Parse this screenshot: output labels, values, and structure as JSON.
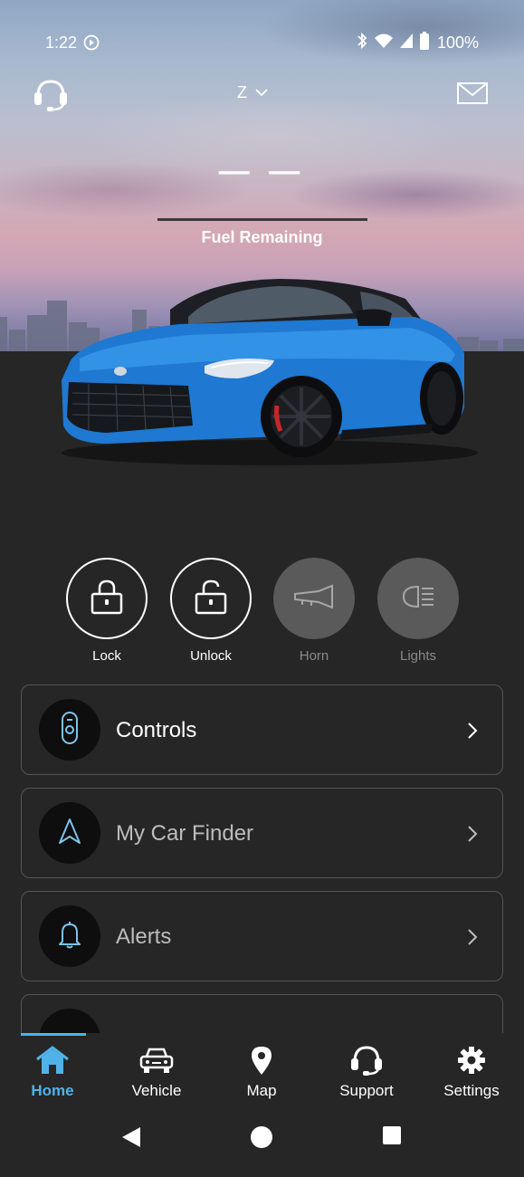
{
  "status_bar": {
    "time": "1:22",
    "battery_percent": "100%",
    "icons": [
      "play-circle-icon",
      "bluetooth-icon",
      "wifi-icon",
      "cell-signal-icon",
      "battery-icon"
    ]
  },
  "top_bar": {
    "support_icon": "headset-icon",
    "vehicle_name": "Z",
    "dropdown_icon": "chevron-down-icon",
    "mail_icon": "mail-icon"
  },
  "fuel": {
    "value": "— —",
    "label": "Fuel Remaining"
  },
  "quick_actions": [
    {
      "label": "Lock",
      "icon": "lock-icon",
      "enabled": true
    },
    {
      "label": "Unlock",
      "icon": "unlock-icon",
      "enabled": true
    },
    {
      "label": "Horn",
      "icon": "horn-icon",
      "enabled": false
    },
    {
      "label": "Lights",
      "icon": "headlight-icon",
      "enabled": false
    }
  ],
  "menu": [
    {
      "label": "Controls",
      "icon": "remote-key-icon"
    },
    {
      "label": "My Car Finder",
      "icon": "navigation-arrow-icon"
    },
    {
      "label": "Alerts",
      "icon": "bell-icon"
    }
  ],
  "bottom_nav": [
    {
      "label": "Home",
      "icon": "home-icon",
      "active": true
    },
    {
      "label": "Vehicle",
      "icon": "car-icon",
      "active": false
    },
    {
      "label": "Map",
      "icon": "map-pin-icon",
      "active": false
    },
    {
      "label": "Support",
      "icon": "headset-icon",
      "active": false
    },
    {
      "label": "Settings",
      "icon": "gear-icon",
      "active": false
    }
  ],
  "colors": {
    "accent": "#4fb3e8",
    "background": "#262626",
    "card_border": "#555555",
    "car_body": "#1f78d1"
  }
}
